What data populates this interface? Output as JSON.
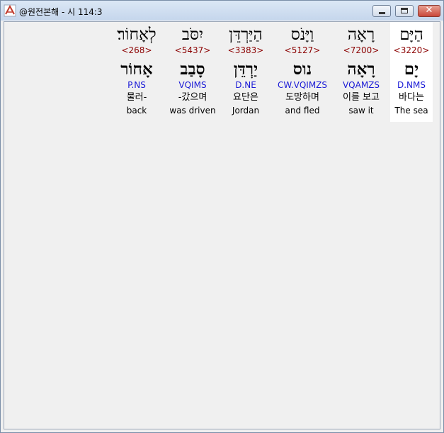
{
  "window": {
    "title": "@원전본해 - 시 114:3",
    "close_glyph": "✕"
  },
  "colors": {
    "strong_number": "#8b0000",
    "morphology": "#1a1ad6",
    "selected_word_bg": "#ffffff"
  },
  "words": [
    {
      "hebrew": "הַיָּם",
      "strong": "<3220>",
      "lemma": "יָם",
      "morph": "D.NMS",
      "korean": "바다는",
      "english": "The sea",
      "selected": true
    },
    {
      "hebrew": "רָאָה",
      "strong": "<7200>",
      "lemma": "רָאָה",
      "morph": "VQAMZS",
      "korean": "이를 보고",
      "english": "saw it",
      "selected": false
    },
    {
      "hebrew": "וַיָּנֹס",
      "strong": "<5127>",
      "lemma": "נוס",
      "morph": "CW.VQIMZS",
      "korean": "도망하며",
      "english": "and fled",
      "selected": false
    },
    {
      "hebrew": "הַיַּרְדֵּן",
      "strong": "<3383>",
      "lemma": "יַרְדֵּן",
      "morph": "D.NE",
      "korean": "요단은",
      "english": "Jordan",
      "selected": false
    },
    {
      "hebrew": "יִסֹּב",
      "strong": "<5437>",
      "lemma": "סָבַב",
      "morph": "VQIMS",
      "korean": "-갔으며",
      "english": "was driven",
      "selected": false
    },
    {
      "hebrew": "לְאָחוֹר׃",
      "strong": "<268>",
      "lemma": "אָחוֹר",
      "morph": "P.NS",
      "korean": "물러-",
      "english": "back",
      "selected": false
    }
  ]
}
